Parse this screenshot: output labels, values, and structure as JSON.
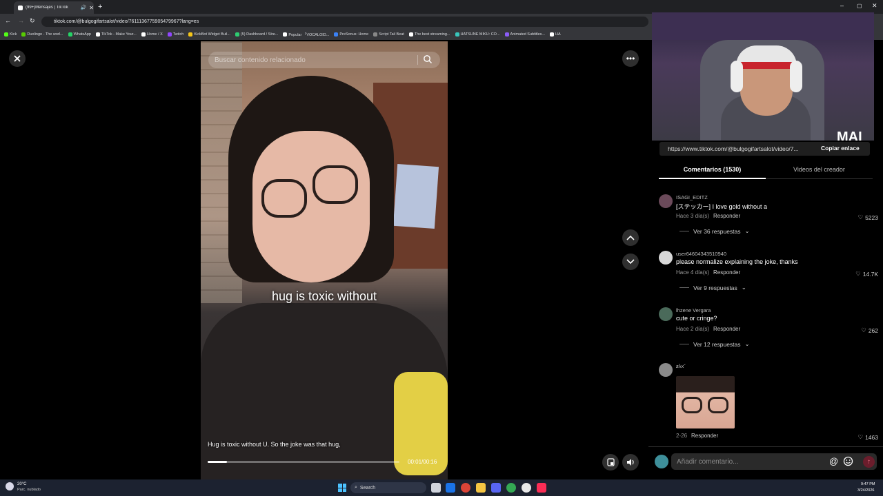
{
  "browser": {
    "tab_title": "(99+)Mensajes | TikTok",
    "url": "tiktok.com/@bulgogifartsalot/video/7611136775905479967?lang=es",
    "bookmarks": [
      {
        "label": "Kick",
        "color": "#53fc18"
      },
      {
        "label": "Duolingo - The worl...",
        "color": "#58cc02"
      },
      {
        "label": "WhatsApp",
        "color": "#25d366"
      },
      {
        "label": "TikTok - Make Your...",
        "color": "#ffffff"
      },
      {
        "label": "Home / X",
        "color": "#ffffff"
      },
      {
        "label": "Twitch",
        "color": "#9146ff"
      },
      {
        "label": "KickBot Widget Buil...",
        "color": "#f5c518"
      },
      {
        "label": "(5) Dashboard / Stre...",
        "color": "#2ecc71"
      },
      {
        "label": "Popular 「VOCALOID...",
        "color": "#ffffff"
      },
      {
        "label": "PreSonus: Home",
        "color": "#3b82f6"
      },
      {
        "label": "Script Tail Beat",
        "color": "#888888"
      },
      {
        "label": "The best streaming...",
        "color": "#ffffff"
      },
      {
        "label": "HATSUNE MIKU: CO...",
        "color": "#39c5bb"
      },
      {
        "label": "Animated Subtitles...",
        "color": "#8b5cf6"
      },
      {
        "label": "HA",
        "color": "#ffffff"
      }
    ]
  },
  "video": {
    "search_placeholder": "Buscar contenido relacionado",
    "overlay_caption": "hug is toxic without",
    "subtitle": "Hug is toxic without U. So the joke was that hug,",
    "time": "00:01/00:16",
    "progress": 0.1
  },
  "right_panel": {
    "webcam_watermark": "MAI",
    "link": "https://www.tiktok.com/@bulgogifartsalot/video/7...",
    "copy_label": "Copiar enlace",
    "tabs": {
      "comments": "Comentarios (1530)",
      "creator": "Videos del creador"
    },
    "comments": [
      {
        "user": "ISAGI_EDITZ",
        "text": "[ステッカー] I love gold without a",
        "time": "Hace 3 día(s)",
        "reply": "Responder",
        "likes": "5223",
        "view_replies": "Ver 36 respuestas",
        "avatar_color": "#6b4a5a"
      },
      {
        "user": "user64604343510940",
        "text": "please normalize explaining the joke, thanks",
        "time": "Hace 4 día(s)",
        "reply": "Responder",
        "likes": "14.7K",
        "view_replies": "Ver 9 respuestas",
        "avatar_color": "#d8d8d8"
      },
      {
        "user": "lhzene Vergara",
        "text": "cute or cringe?",
        "time": "Hace 2 día(s)",
        "reply": "Responder",
        "likes": "262",
        "view_replies": "Ver 12 respuestas",
        "avatar_color": "#4a6a5a"
      },
      {
        "user": "ƶλx˘",
        "text": "",
        "time": "2-26",
        "reply": "Responder",
        "likes": "1463",
        "view_replies": "",
        "avatar_color": "#8a8a8a"
      }
    ],
    "comment_placeholder": "Añadir comentario...",
    "mention_symbol": "@"
  },
  "taskbar": {
    "weather_temp": "20°C",
    "weather_desc": "Parc. nublado",
    "search_label": "Search",
    "clock_time": "9:47 PM",
    "clock_date": "3/24/2026"
  }
}
